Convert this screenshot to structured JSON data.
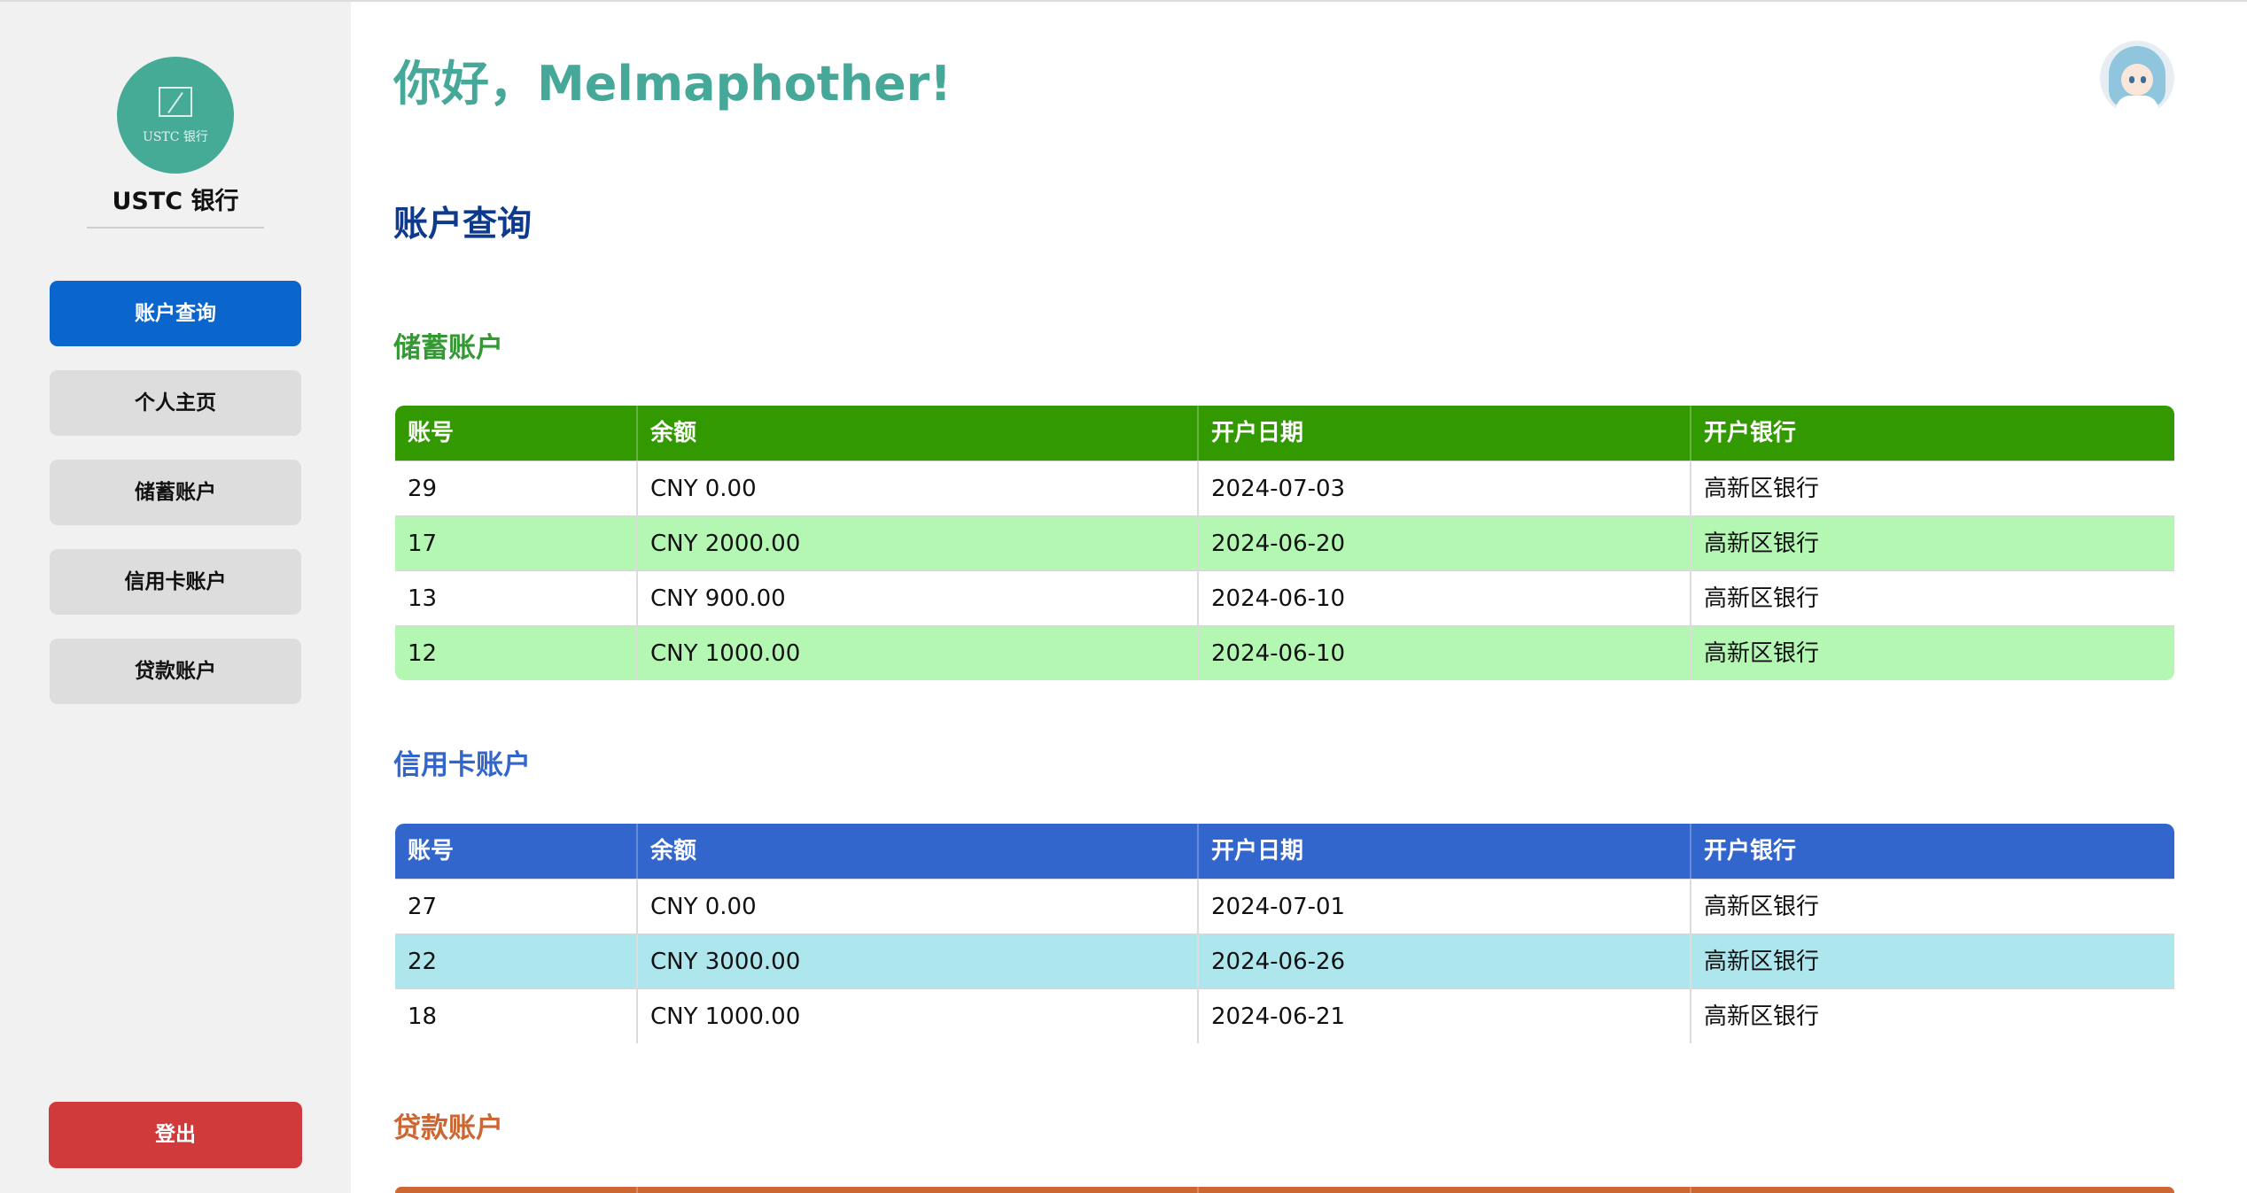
{
  "sidebar": {
    "logo_text": "USTC 银行",
    "bank_name": "USTC 银行",
    "nav": [
      {
        "label": "账户查询",
        "active": true
      },
      {
        "label": "个人主页",
        "active": false
      },
      {
        "label": "储蓄账户",
        "active": false
      },
      {
        "label": "信用卡账户",
        "active": false
      },
      {
        "label": "贷款账户",
        "active": false
      }
    ],
    "logout_label": "登出"
  },
  "header": {
    "greeting": "你好，Melmaphother!"
  },
  "main": {
    "page_title": "账户查询",
    "columns": [
      "账号",
      "余额",
      "开户日期",
      "开户银行"
    ],
    "sections": [
      {
        "title": "储蓄账户",
        "title_color": "#339933",
        "header_color": "#339900",
        "stripe_color": "#b3f7b3",
        "rows": [
          [
            "29",
            "CNY 0.00",
            "2024-07-03",
            "高新区银行"
          ],
          [
            "17",
            "CNY 2000.00",
            "2024-06-20",
            "高新区银行"
          ],
          [
            "13",
            "CNY 900.00",
            "2024-06-10",
            "高新区银行"
          ],
          [
            "12",
            "CNY 1000.00",
            "2024-06-10",
            "高新区银行"
          ]
        ]
      },
      {
        "title": "信用卡账户",
        "title_color": "#3366cc",
        "header_color": "#3366cc",
        "stripe_color": "#ade6ed",
        "rows": [
          [
            "27",
            "CNY 0.00",
            "2024-07-01",
            "高新区银行"
          ],
          [
            "22",
            "CNY 3000.00",
            "2024-06-26",
            "高新区银行"
          ],
          [
            "18",
            "CNY 1000.00",
            "2024-06-21",
            "高新区银行"
          ]
        ]
      },
      {
        "title": "贷款账户",
        "title_color": "#cc6633",
        "header_color": "#cc6633",
        "stripe_color": "#f6d6c4",
        "rows": []
      }
    ]
  },
  "icons": {
    "logo": "ustc-bank-logo-icon",
    "avatar": "user-avatar-icon"
  }
}
